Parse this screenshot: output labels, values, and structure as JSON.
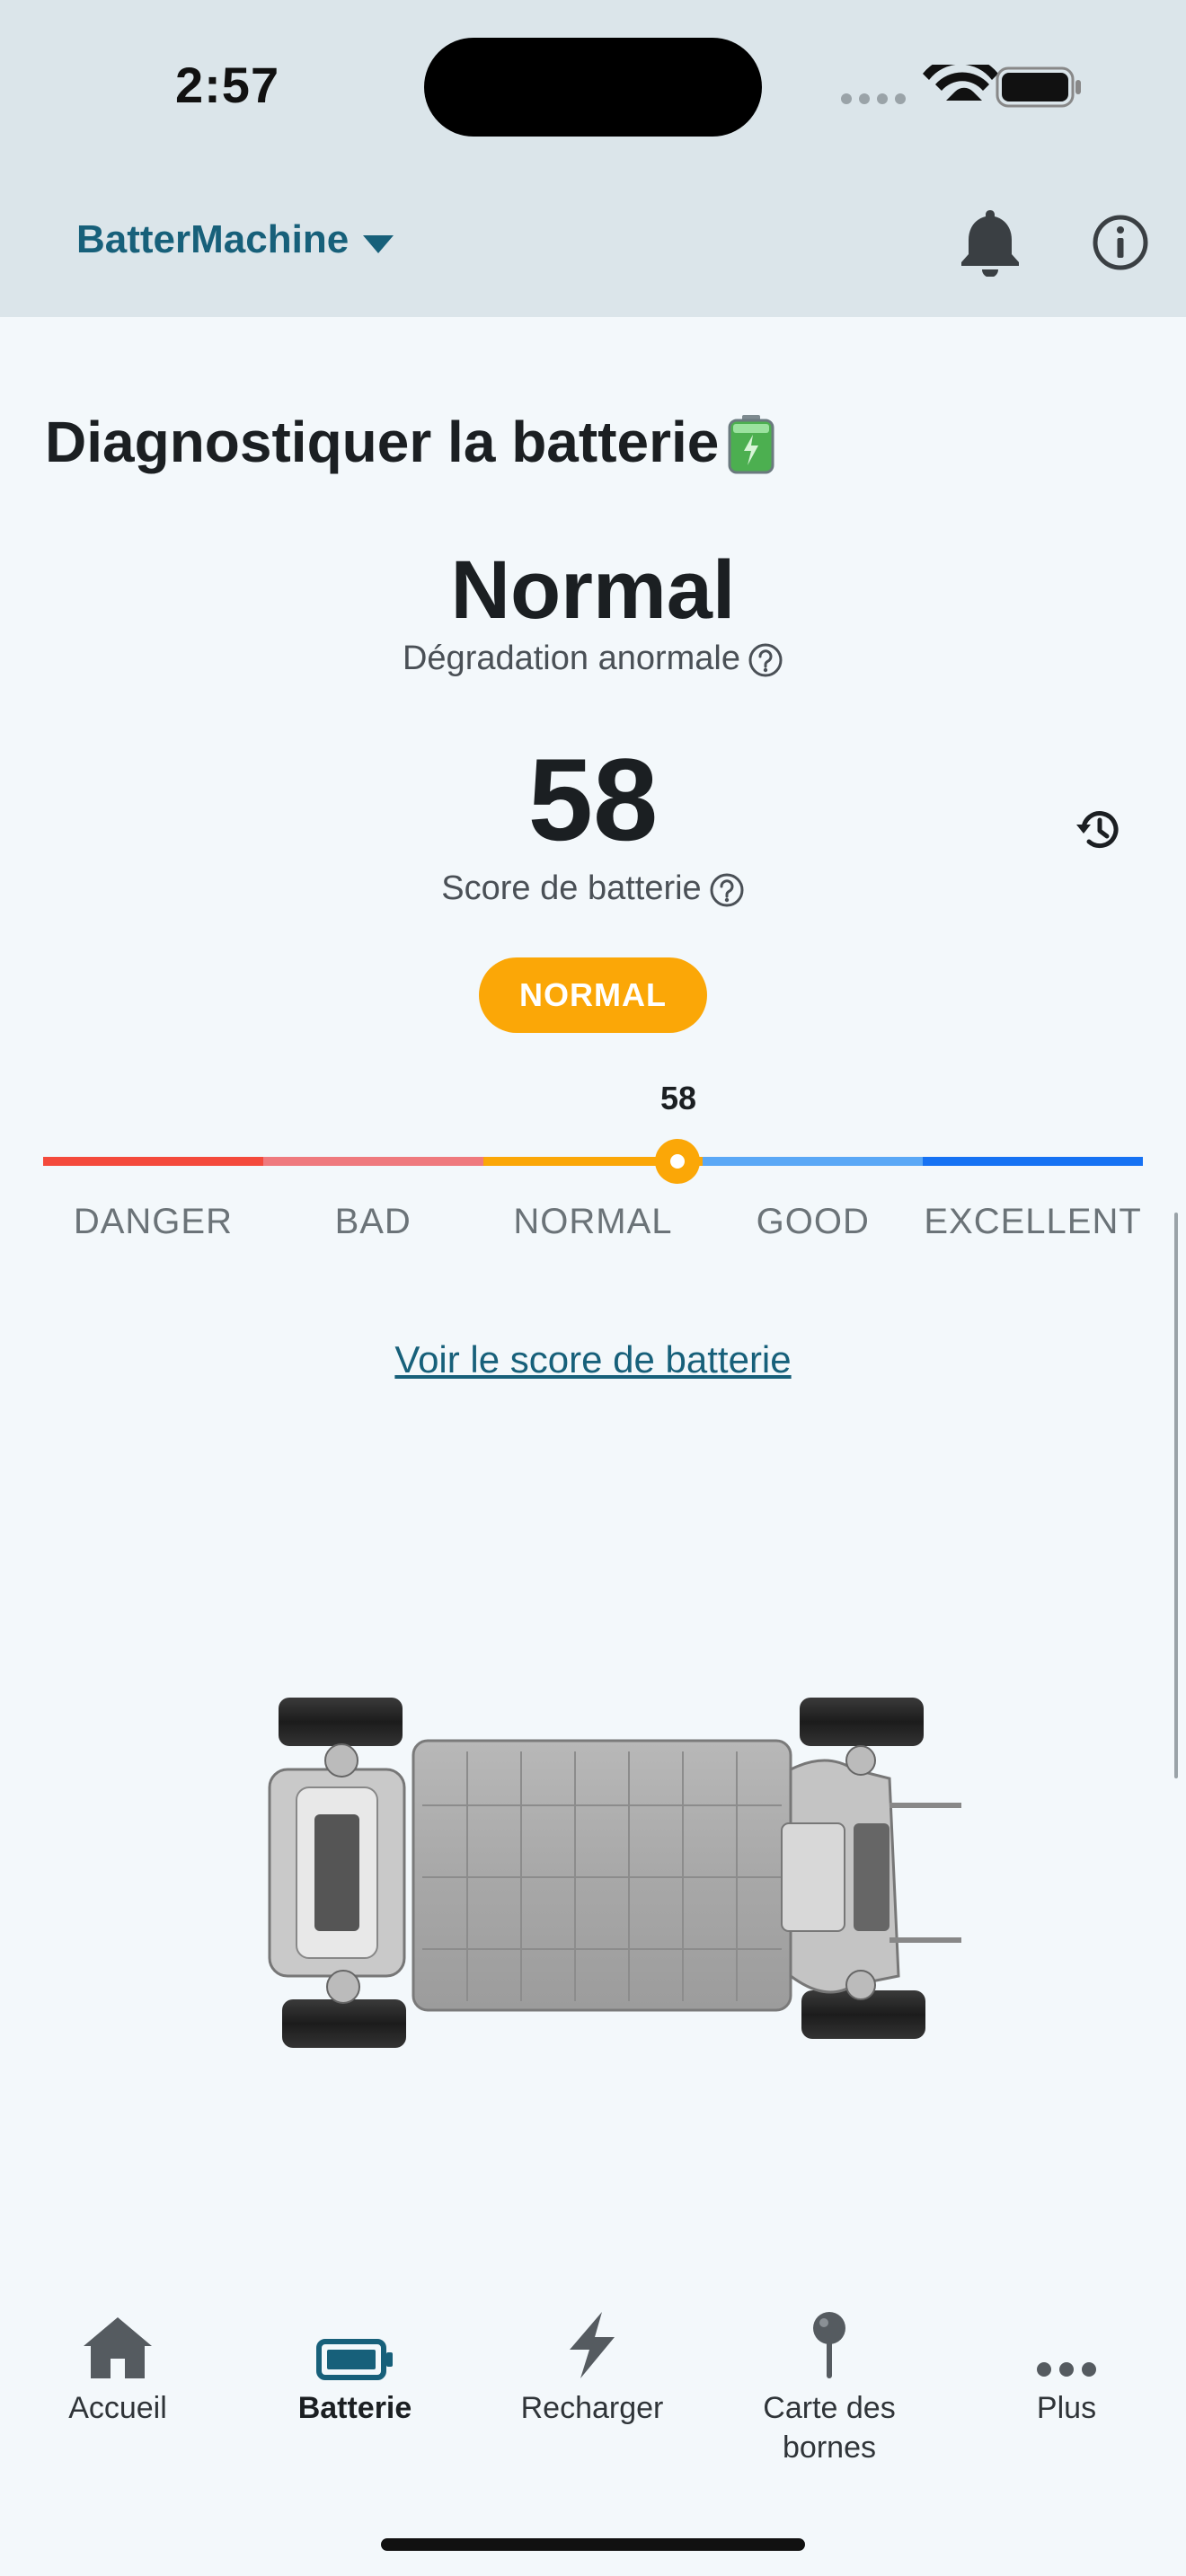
{
  "status_bar": {
    "time": "2:57"
  },
  "header": {
    "account_name": "BatterMachine"
  },
  "page": {
    "title": "Diagnostiquer la batterie",
    "status": "Normal",
    "status_sub": "Dégradation anormale",
    "score": "58",
    "score_label": "Score de batterie",
    "badge": "NORMAL",
    "marker_value": "58",
    "gauge": {
      "value": 58,
      "labels": [
        "DANGER",
        "BAD",
        "NORMAL",
        "GOOD",
        "EXCELLENT"
      ],
      "colors": [
        "#f44a3c",
        "#ef7a7e",
        "#fba707",
        "#5aa8f6",
        "#1672f3"
      ]
    },
    "link": "Voir le score de batterie"
  },
  "tabs": [
    {
      "label": "Accueil",
      "icon": "home-icon",
      "active": false
    },
    {
      "label": "Batterie",
      "icon": "battery-icon",
      "active": true
    },
    {
      "label": "Recharger",
      "icon": "lightning-icon",
      "active": false
    },
    {
      "label": "Carte des bornes",
      "icon": "map-pin-icon",
      "active": false
    },
    {
      "label": "Plus",
      "icon": "more-icon",
      "active": false
    }
  ],
  "colors": {
    "accent": "#17607a",
    "normal": "#fba707",
    "header_bg": "#dbe5ea",
    "page_bg": "#f3f8fb"
  }
}
